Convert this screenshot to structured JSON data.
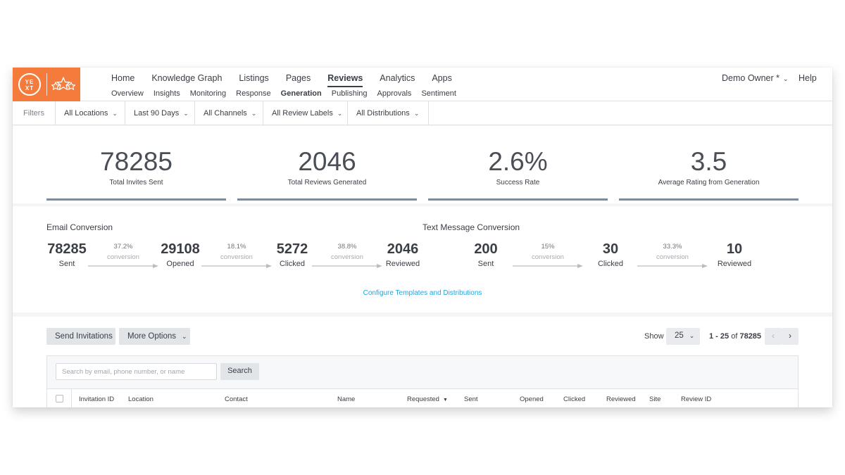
{
  "brand": {
    "logo_text": "YE XT",
    "accent": "#f47b3c"
  },
  "nav": {
    "main": [
      "Home",
      "Knowledge Graph",
      "Listings",
      "Pages",
      "Reviews",
      "Analytics",
      "Apps"
    ],
    "main_active": "Reviews",
    "sub": [
      "Overview",
      "Insights",
      "Monitoring",
      "Response",
      "Generation",
      "Publishing",
      "Approvals",
      "Sentiment"
    ],
    "sub_active": "Generation",
    "user": "Demo Owner *",
    "help": "Help"
  },
  "filters": {
    "label": "Filters",
    "items": [
      "All Locations",
      "Last 90 Days",
      "All Channels",
      "All Review Labels",
      "All Distributions"
    ]
  },
  "stats": [
    {
      "value": "78285",
      "label": "Total Invites Sent"
    },
    {
      "value": "2046",
      "label": "Total Reviews Generated"
    },
    {
      "value": "2.6%",
      "label": "Success Rate"
    },
    {
      "value": "3.5",
      "label": "Average Rating from Generation"
    }
  ],
  "email_conversion": {
    "title": "Email Conversion",
    "nodes": [
      {
        "value": "78285",
        "label": "Sent"
      },
      {
        "value": "29108",
        "label": "Opened"
      },
      {
        "value": "5272",
        "label": "Clicked"
      },
      {
        "value": "2046",
        "label": "Reviewed"
      }
    ],
    "rates": [
      "37.2%",
      "18.1%",
      "38.8%"
    ]
  },
  "text_conversion": {
    "title": "Text Message Conversion",
    "nodes": [
      {
        "value": "200",
        "label": "Sent"
      },
      {
        "value": "30",
        "label": "Clicked"
      },
      {
        "value": "10",
        "label": "Reviewed"
      }
    ],
    "rates": [
      "15%",
      "33.3%"
    ]
  },
  "conversion_word": "conversion",
  "config_link": "Configure Templates and Distributions",
  "toolbar": {
    "send_invitations": "Send Invitations",
    "more_options": "More Options",
    "show_label": "Show",
    "page_size": "25",
    "range_text": "1 - 25",
    "range_of": "of",
    "range_total": "78285"
  },
  "search": {
    "placeholder": "Search by email, phone number, or name",
    "button": "Search"
  },
  "table": {
    "columns": [
      "Invitation ID",
      "Location",
      "Contact",
      "Name",
      "Requested",
      "Sent",
      "Opened",
      "Clicked",
      "Reviewed",
      "Site",
      "Review ID"
    ]
  }
}
